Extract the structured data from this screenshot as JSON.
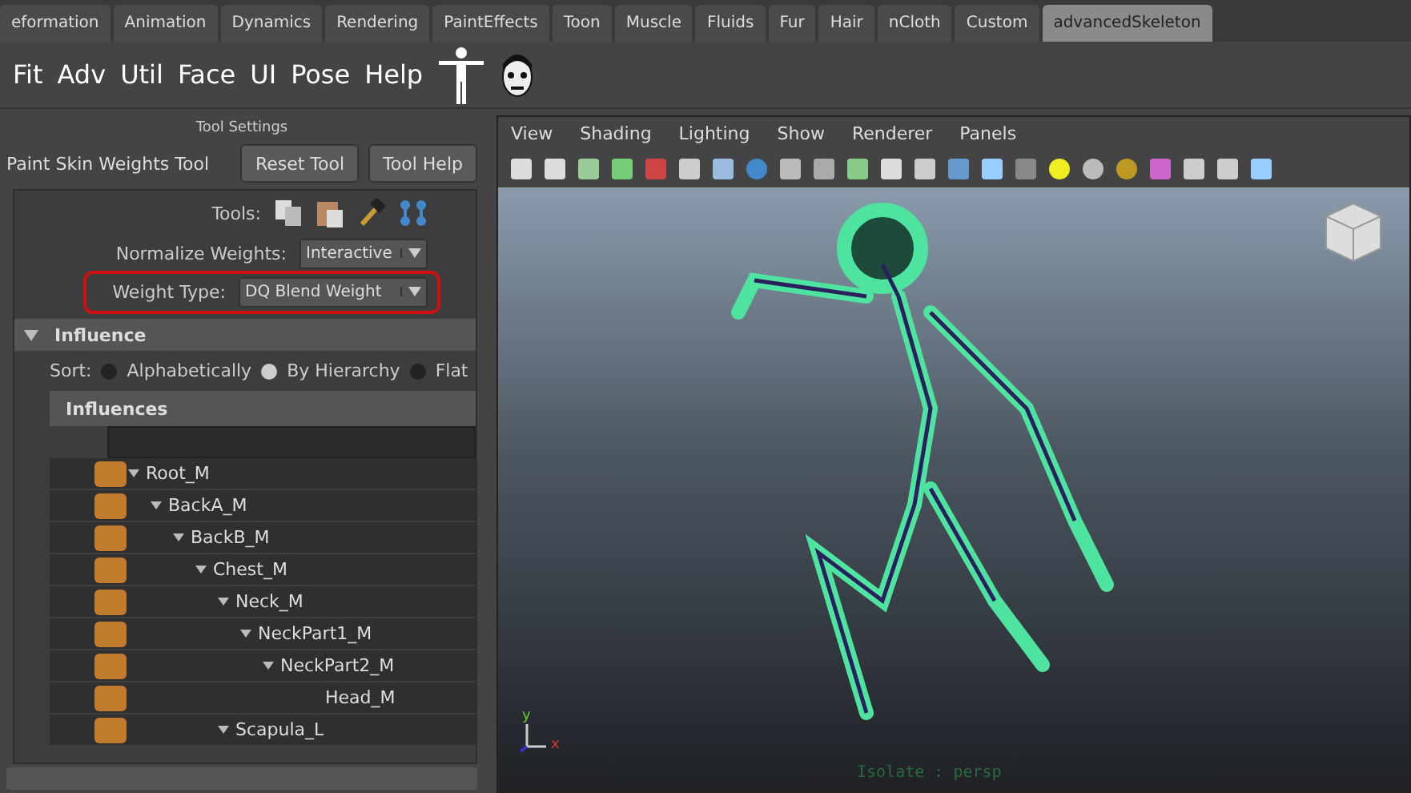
{
  "shelf_tabs": [
    {
      "label": "eformation",
      "selected": false
    },
    {
      "label": "Animation",
      "selected": false
    },
    {
      "label": "Dynamics",
      "selected": false
    },
    {
      "label": "Rendering",
      "selected": false
    },
    {
      "label": "PaintEffects",
      "selected": false
    },
    {
      "label": "Toon",
      "selected": false
    },
    {
      "label": "Muscle",
      "selected": false
    },
    {
      "label": "Fluids",
      "selected": false
    },
    {
      "label": "Fur",
      "selected": false
    },
    {
      "label": "Hair",
      "selected": false
    },
    {
      "label": "nCloth",
      "selected": false
    },
    {
      "label": "Custom",
      "selected": false
    },
    {
      "label": "advancedSkeleton",
      "selected": true
    }
  ],
  "shelf_buttons": [
    "Fit",
    "Adv",
    "Util",
    "Face",
    "UI",
    "Pose",
    "Help"
  ],
  "tool_settings": {
    "title": "Tool Settings",
    "tool_name": "Paint Skin Weights Tool",
    "buttons": [
      "Reset Tool",
      "Tool Help"
    ],
    "tools_label": "Tools:",
    "fields": [
      {
        "label": "Normalize Weights:",
        "value": "Interactive",
        "highlighted": false
      },
      {
        "label": "Weight Type:",
        "value": "DQ Blend Weight",
        "highlighted": true
      }
    ],
    "section": {
      "title": "Influence",
      "expanded": true
    },
    "sort": {
      "label": "Sort:",
      "options": [
        {
          "label": "Alphabetically",
          "selected": false
        },
        {
          "label": "By Hierarchy",
          "selected": true
        },
        {
          "label": "Flat",
          "selected": false
        }
      ]
    },
    "influences_title": "Influences",
    "tree": [
      {
        "name": "Root_M",
        "expanded": true,
        "children": [
          {
            "name": "BackA_M",
            "expanded": true,
            "children": [
              {
                "name": "BackB_M",
                "expanded": true,
                "children": [
                  {
                    "name": "Chest_M",
                    "expanded": true,
                    "children": [
                      {
                        "name": "Neck_M",
                        "expanded": true,
                        "children": [
                          {
                            "name": "NeckPart1_M",
                            "expanded": true,
                            "children": [
                              {
                                "name": "NeckPart2_M",
                                "expanded": true,
                                "children": [
                                  {
                                    "name": "Head_M",
                                    "expanded": false
                                  }
                                ]
                              }
                            ]
                          }
                        ]
                      },
                      {
                        "name": "Scapula_L",
                        "expanded": true
                      }
                    ]
                  }
                ]
              }
            ]
          }
        ]
      }
    ]
  },
  "viewport": {
    "menu": [
      "View",
      "Shading",
      "Lighting",
      "Show",
      "Renderer",
      "Panels"
    ],
    "camera_label": "Isolate : persp",
    "axis_labels": [
      "y",
      "x"
    ]
  }
}
